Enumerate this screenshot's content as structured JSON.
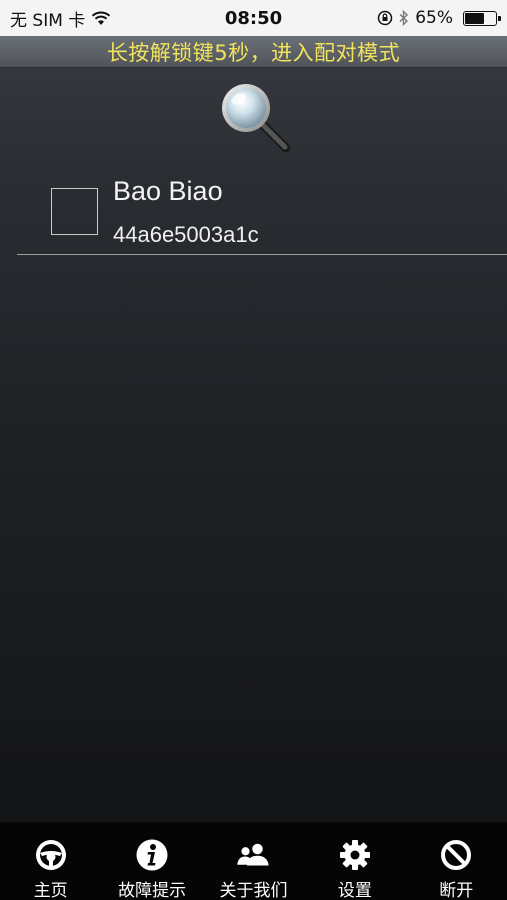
{
  "status_bar": {
    "carrier": "无 SIM 卡",
    "time": "08:50",
    "battery_percent_label": "65%",
    "battery_level": 0.65
  },
  "banner": {
    "text": "长按解锁键5秒，进入配对模式"
  },
  "search": {
    "icon": "magnifier-icon"
  },
  "devices": [
    {
      "name": "Bao Biao",
      "id": "44a6e5003a1c",
      "checked": false
    }
  ],
  "tab_bar": {
    "tabs": [
      {
        "label": "主页",
        "icon": "steering-wheel-icon"
      },
      {
        "label": "故障提示",
        "icon": "info-icon"
      },
      {
        "label": "关于我们",
        "icon": "users-icon"
      },
      {
        "label": "设置",
        "icon": "gear-icon"
      },
      {
        "label": "断开",
        "icon": "disconnect-icon"
      }
    ]
  },
  "colors": {
    "banner_text": "#f2e45a",
    "background_top": "#3a3d43",
    "background_bottom": "#141517"
  }
}
